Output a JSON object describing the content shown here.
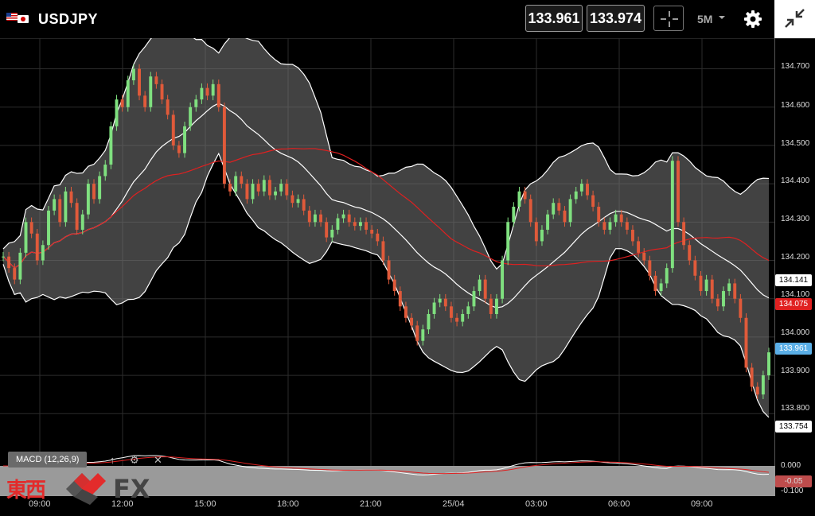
{
  "header": {
    "symbol": "USDJPY",
    "bid": "133.961",
    "ask": "133.974",
    "timeframe": "5M",
    "icons": [
      "flag-us-icon",
      "flag-jp-icon",
      "crosshair-icon",
      "chevron-down-icon",
      "gear-icon",
      "collapse-icon"
    ]
  },
  "price_axis": [
    "134.700",
    "134.600",
    "134.500",
    "134.400",
    "134.300",
    "134.200",
    "134.100",
    "134.000",
    "133.900",
    "133.800"
  ],
  "tags": {
    "upper_band": "134.141",
    "moving_average": "134.075",
    "last_price": "133.961",
    "lower_band": "133.754"
  },
  "macd": {
    "label": "MACD (12,26,9)",
    "axis": [
      "0.000",
      "-0.100"
    ],
    "value": "-0.05"
  },
  "time_axis": [
    "09:00",
    "12:00",
    "15:00",
    "18:00",
    "21:00",
    "25/04",
    "03:00",
    "06:00",
    "09:00"
  ],
  "logo": {
    "kanji": "東西",
    "text": "FX"
  },
  "colors": {
    "up": "#7fe07f",
    "down": "#e05a3a",
    "ma": "#e02020",
    "last": "#5aaee6",
    "band": "#ffffff"
  },
  "chart_data": {
    "type": "candlestick",
    "ylim": [
      133.73,
      134.78
    ],
    "close": [
      134.21,
      134.18,
      134.15,
      134.22,
      134.3,
      134.27,
      134.2,
      134.24,
      134.33,
      134.36,
      134.3,
      134.38,
      134.35,
      134.28,
      134.32,
      134.4,
      134.36,
      134.42,
      134.45,
      134.55,
      134.62,
      134.6,
      134.67,
      134.7,
      134.63,
      134.6,
      134.68,
      134.66,
      134.62,
      134.58,
      134.5,
      134.48,
      134.55,
      134.6,
      134.62,
      134.65,
      134.63,
      134.66,
      134.6,
      134.4,
      134.38,
      134.42,
      134.4,
      134.36,
      134.4,
      134.38,
      134.41,
      134.37,
      134.38,
      134.4,
      134.37,
      134.35,
      134.36,
      134.33,
      134.3,
      134.32,
      134.3,
      134.26,
      134.28,
      134.31,
      134.32,
      134.3,
      134.29,
      134.3,
      134.28,
      134.27,
      134.25,
      134.2,
      134.15,
      134.12,
      134.08,
      134.05,
      134.03,
      133.99,
      134.02,
      134.06,
      134.09,
      134.1,
      134.08,
      134.05,
      134.04,
      134.06,
      134.08,
      134.12,
      134.15,
      134.1,
      134.06,
      134.1,
      134.2,
      134.3,
      134.34,
      134.38,
      134.36,
      134.3,
      134.25,
      134.28,
      134.32,
      134.35,
      134.33,
      134.3,
      134.36,
      134.38,
      134.4,
      134.37,
      134.34,
      134.3,
      134.28,
      134.3,
      134.32,
      134.3,
      134.28,
      134.25,
      134.22,
      134.2,
      134.16,
      134.12,
      134.14,
      134.18,
      134.46,
      134.3,
      134.24,
      134.2,
      134.16,
      134.12,
      134.15,
      134.1,
      134.08,
      134.12,
      134.14,
      134.1,
      134.05,
      133.92,
      133.87,
      133.85,
      133.9,
      133.96
    ]
  }
}
